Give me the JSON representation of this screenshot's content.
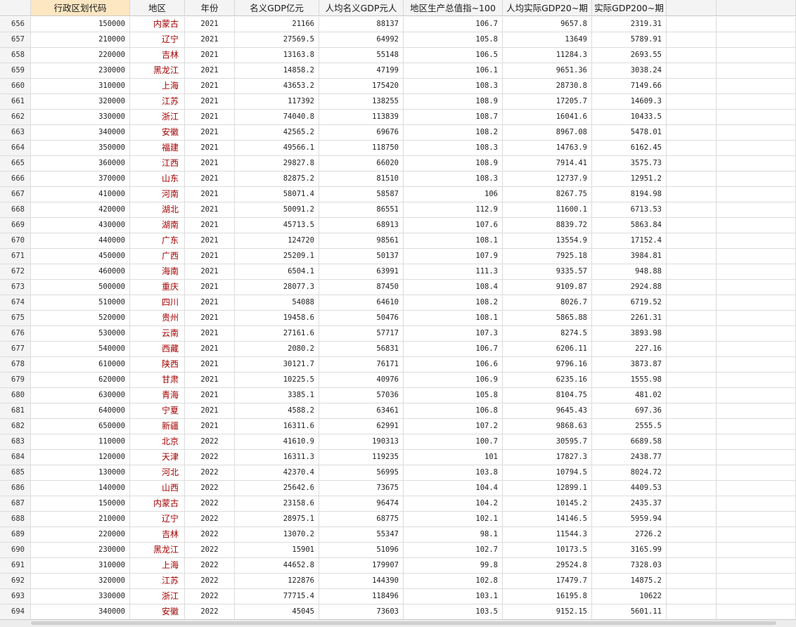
{
  "columns": [
    {
      "label": "",
      "name": "row-number-header"
    },
    {
      "label": "行政区划代码",
      "name": "col-header-code"
    },
    {
      "label": "地区",
      "name": "col-header-region"
    },
    {
      "label": "年份",
      "name": "col-header-year"
    },
    {
      "label": "名义GDP亿元",
      "name": "col-header-gdp"
    },
    {
      "label": "人均名义GDP元人",
      "name": "col-header-gdp-per-capita"
    },
    {
      "label": "地区生产总值指~100",
      "name": "col-header-gdp-index"
    },
    {
      "label": "人均实际GDP20~期",
      "name": "col-header-real-gdp-per-capita"
    },
    {
      "label": "实际GDP200~期",
      "name": "col-header-real-gdp"
    },
    {
      "label": "",
      "name": "col-header-empty-1"
    },
    {
      "label": "",
      "name": "col-header-empty-2"
    }
  ],
  "rows": [
    [
      "656",
      "150000",
      "内蒙古",
      "2021",
      "21166",
      "88137",
      "106.7",
      "9657.8",
      "2319.31"
    ],
    [
      "657",
      "210000",
      "辽宁",
      "2021",
      "27569.5",
      "64992",
      "105.8",
      "13649",
      "5789.91"
    ],
    [
      "658",
      "220000",
      "吉林",
      "2021",
      "13163.8",
      "55148",
      "106.5",
      "11284.3",
      "2693.55"
    ],
    [
      "659",
      "230000",
      "黑龙江",
      "2021",
      "14858.2",
      "47199",
      "106.1",
      "9651.36",
      "3038.24"
    ],
    [
      "660",
      "310000",
      "上海",
      "2021",
      "43653.2",
      "175420",
      "108.3",
      "28730.8",
      "7149.66"
    ],
    [
      "661",
      "320000",
      "江苏",
      "2021",
      "117392",
      "138255",
      "108.9",
      "17205.7",
      "14609.3"
    ],
    [
      "662",
      "330000",
      "浙江",
      "2021",
      "74040.8",
      "113839",
      "108.7",
      "16041.6",
      "10433.5"
    ],
    [
      "663",
      "340000",
      "安徽",
      "2021",
      "42565.2",
      "69676",
      "108.2",
      "8967.08",
      "5478.01"
    ],
    [
      "664",
      "350000",
      "福建",
      "2021",
      "49566.1",
      "118750",
      "108.3",
      "14763.9",
      "6162.45"
    ],
    [
      "665",
      "360000",
      "江西",
      "2021",
      "29827.8",
      "66020",
      "108.9",
      "7914.41",
      "3575.73"
    ],
    [
      "666",
      "370000",
      "山东",
      "2021",
      "82875.2",
      "81510",
      "108.3",
      "12737.9",
      "12951.2"
    ],
    [
      "667",
      "410000",
      "河南",
      "2021",
      "58071.4",
      "58587",
      "106",
      "8267.75",
      "8194.98"
    ],
    [
      "668",
      "420000",
      "湖北",
      "2021",
      "50091.2",
      "86551",
      "112.9",
      "11600.1",
      "6713.53"
    ],
    [
      "669",
      "430000",
      "湖南",
      "2021",
      "45713.5",
      "68913",
      "107.6",
      "8839.72",
      "5863.84"
    ],
    [
      "670",
      "440000",
      "广东",
      "2021",
      "124720",
      "98561",
      "108.1",
      "13554.9",
      "17152.4"
    ],
    [
      "671",
      "450000",
      "广西",
      "2021",
      "25209.1",
      "50137",
      "107.9",
      "7925.18",
      "3984.81"
    ],
    [
      "672",
      "460000",
      "海南",
      "2021",
      "6504.1",
      "63991",
      "111.3",
      "9335.57",
      "948.88"
    ],
    [
      "673",
      "500000",
      "重庆",
      "2021",
      "28077.3",
      "87450",
      "108.4",
      "9109.87",
      "2924.88"
    ],
    [
      "674",
      "510000",
      "四川",
      "2021",
      "54088",
      "64610",
      "108.2",
      "8026.7",
      "6719.52"
    ],
    [
      "675",
      "520000",
      "贵州",
      "2021",
      "19458.6",
      "50476",
      "108.1",
      "5865.88",
      "2261.31"
    ],
    [
      "676",
      "530000",
      "云南",
      "2021",
      "27161.6",
      "57717",
      "107.3",
      "8274.5",
      "3893.98"
    ],
    [
      "677",
      "540000",
      "西藏",
      "2021",
      "2080.2",
      "56831",
      "106.7",
      "6206.11",
      "227.16"
    ],
    [
      "678",
      "610000",
      "陕西",
      "2021",
      "30121.7",
      "76171",
      "106.6",
      "9796.16",
      "3873.87"
    ],
    [
      "679",
      "620000",
      "甘肃",
      "2021",
      "10225.5",
      "40976",
      "106.9",
      "6235.16",
      "1555.98"
    ],
    [
      "680",
      "630000",
      "青海",
      "2021",
      "3385.1",
      "57036",
      "105.8",
      "8104.75",
      "481.02"
    ],
    [
      "681",
      "640000",
      "宁夏",
      "2021",
      "4588.2",
      "63461",
      "106.8",
      "9645.43",
      "697.36"
    ],
    [
      "682",
      "650000",
      "新疆",
      "2021",
      "16311.6",
      "62991",
      "107.2",
      "9868.63",
      "2555.5"
    ],
    [
      "683",
      "110000",
      "北京",
      "2022",
      "41610.9",
      "190313",
      "100.7",
      "30595.7",
      "6689.58"
    ],
    [
      "684",
      "120000",
      "天津",
      "2022",
      "16311.3",
      "119235",
      "101",
      "17827.3",
      "2438.77"
    ],
    [
      "685",
      "130000",
      "河北",
      "2022",
      "42370.4",
      "56995",
      "103.8",
      "10794.5",
      "8024.72"
    ],
    [
      "686",
      "140000",
      "山西",
      "2022",
      "25642.6",
      "73675",
      "104.4",
      "12899.1",
      "4409.53"
    ],
    [
      "687",
      "150000",
      "内蒙古",
      "2022",
      "23158.6",
      "96474",
      "104.2",
      "10145.2",
      "2435.37"
    ],
    [
      "688",
      "210000",
      "辽宁",
      "2022",
      "28975.1",
      "68775",
      "102.1",
      "14146.5",
      "5959.94"
    ],
    [
      "689",
      "220000",
      "吉林",
      "2022",
      "13070.2",
      "55347",
      "98.1",
      "11544.3",
      "2726.2"
    ],
    [
      "690",
      "230000",
      "黑龙江",
      "2022",
      "15901",
      "51096",
      "102.7",
      "10173.5",
      "3165.99"
    ],
    [
      "691",
      "310000",
      "上海",
      "2022",
      "44652.8",
      "179907",
      "99.8",
      "29524.8",
      "7328.03"
    ],
    [
      "692",
      "320000",
      "江苏",
      "2022",
      "122876",
      "144390",
      "102.8",
      "17479.7",
      "14875.2"
    ],
    [
      "693",
      "330000",
      "浙江",
      "2022",
      "77715.4",
      "118496",
      "103.1",
      "16195.8",
      "10622"
    ],
    [
      "694",
      "340000",
      "安徽",
      "2022",
      "45045",
      "73603",
      "103.5",
      "9152.15",
      "5601.11"
    ]
  ]
}
